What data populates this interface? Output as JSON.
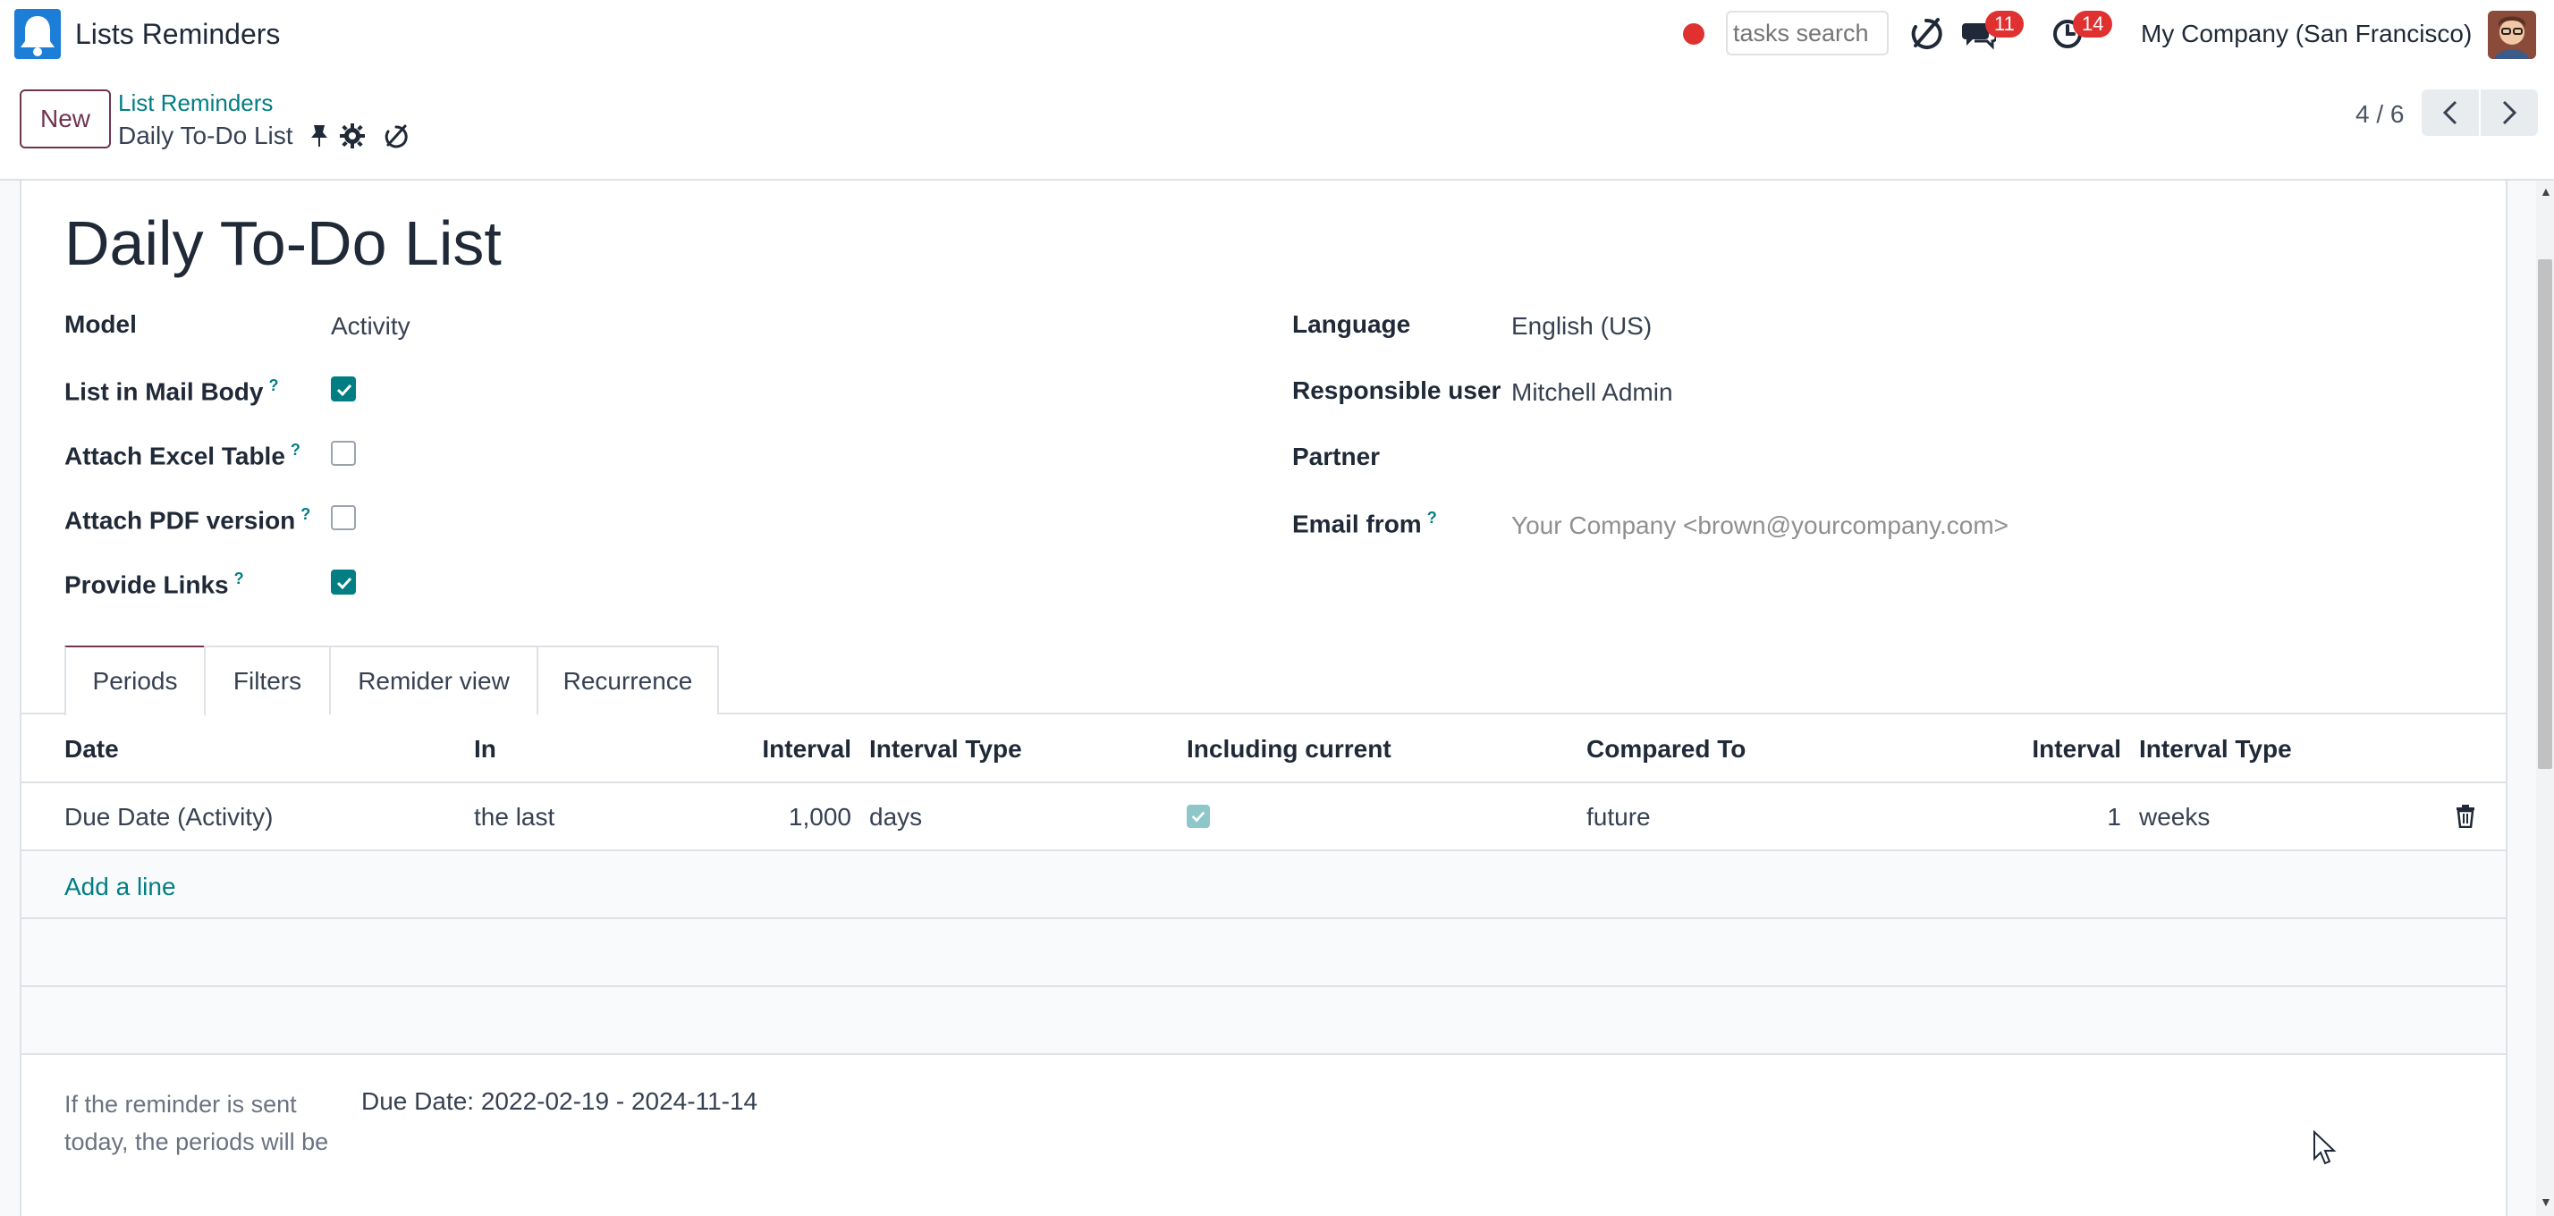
{
  "navbar": {
    "app_title": "Lists Reminders",
    "search_placeholder": "tasks search",
    "messages_count": "11",
    "activities_count": "14",
    "company": "My Company (San Francisco)"
  },
  "control_panel": {
    "new_label": "New",
    "breadcrumb": "List Reminders",
    "record_name": "Daily To-Do List",
    "pager": "4 / 6"
  },
  "form": {
    "title": "Daily To-Do List",
    "left_fields": {
      "model_label": "Model",
      "model_value": "Activity",
      "list_in_mail_body_label": "List in Mail Body",
      "list_in_mail_body": true,
      "attach_excel_label": "Attach Excel Table",
      "attach_excel": false,
      "attach_pdf_label": "Attach PDF version",
      "attach_pdf": false,
      "provide_links_label": "Provide Links",
      "provide_links": true
    },
    "right_fields": {
      "language_label": "Language",
      "language_value": "English (US)",
      "responsible_label": "Responsible user",
      "responsible_value": "Mitchell Admin",
      "partner_label": "Partner",
      "partner_value": "",
      "email_from_label": "Email from",
      "email_from_placeholder": "Your Company <brown@yourcompany.com>"
    },
    "help_mark": "?",
    "tabs": [
      "Periods",
      "Filters",
      "Remider view",
      "Recurrence"
    ],
    "active_tab": "Periods",
    "periods_table": {
      "headers": [
        "Date",
        "In",
        "Interval",
        "Interval Type",
        "Including current",
        "Compared To",
        "Interval",
        "Interval Type"
      ],
      "rows": [
        {
          "date": "Due Date (Activity)",
          "in": "the last",
          "interval": "1,000",
          "interval_type": "days",
          "including_current": true,
          "compared_to": "future",
          "interval2": "1",
          "interval_type2": "weeks"
        }
      ],
      "add_line": "Add a line"
    },
    "periods_note_label": "If the reminder is sent today, the periods will be",
    "periods_note_value": "Due Date: 2022-02-19 - 2024-11-14"
  },
  "colors": {
    "primary": "#71344f",
    "link": "#017e84",
    "badge": "#e03131"
  }
}
